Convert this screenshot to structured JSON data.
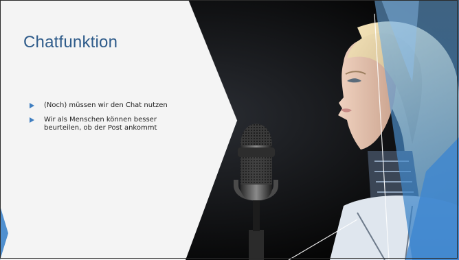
{
  "slide": {
    "title": "Chatfunktion",
    "bullets": [
      {
        "text": "(Noch) müssen wir den Chat nutzen"
      },
      {
        "text": "Wir als Menschen können besser beurteilen, ob der Post ankommt"
      }
    ]
  },
  "colors": {
    "title": "#2e5b8a",
    "bullet_marker": "#3f7ec0",
    "panel": "#f4f4f4",
    "accent_blue": "#5aa0dd",
    "background": "#0a0a0a"
  },
  "icons": {
    "bullet": "triangle-right-icon",
    "microphone": "microphone-icon"
  }
}
